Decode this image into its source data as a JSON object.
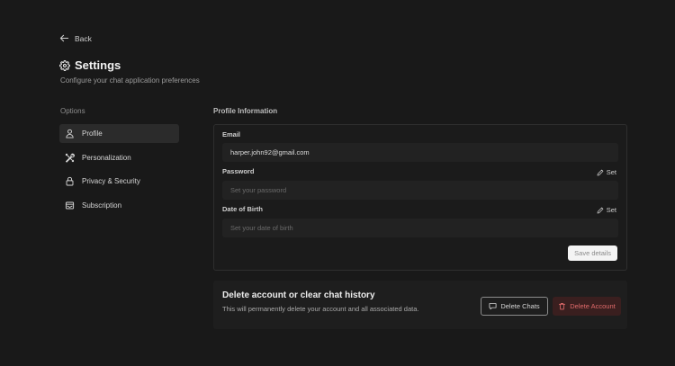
{
  "back": {
    "label": "Back"
  },
  "header": {
    "title": "Settings",
    "subtitle": "Configure your chat application preferences"
  },
  "sidebar": {
    "heading": "Options",
    "items": [
      {
        "label": "Profile",
        "icon": "user-icon",
        "active": true
      },
      {
        "label": "Personalization",
        "icon": "tools-icon",
        "active": false
      },
      {
        "label": "Privacy & Security",
        "icon": "lock-icon",
        "active": false
      },
      {
        "label": "Subscription",
        "icon": "card-icon",
        "active": false
      }
    ]
  },
  "profile": {
    "heading": "Profile Information",
    "email": {
      "label": "Email",
      "value": "harper.john92@gmail.com"
    },
    "password": {
      "label": "Password",
      "placeholder": "Set your password",
      "action": "Set"
    },
    "dob": {
      "label": "Date of Birth",
      "placeholder": "Set your date of birth",
      "action": "Set"
    },
    "save_label": "Save details"
  },
  "danger": {
    "title": "Delete account or clear chat history",
    "description": "This will permanently delete your account and all associated data.",
    "delete_chats_label": "Delete Chats",
    "delete_account_label": "Delete Account",
    "delete_account_color": "#e06a6a"
  }
}
